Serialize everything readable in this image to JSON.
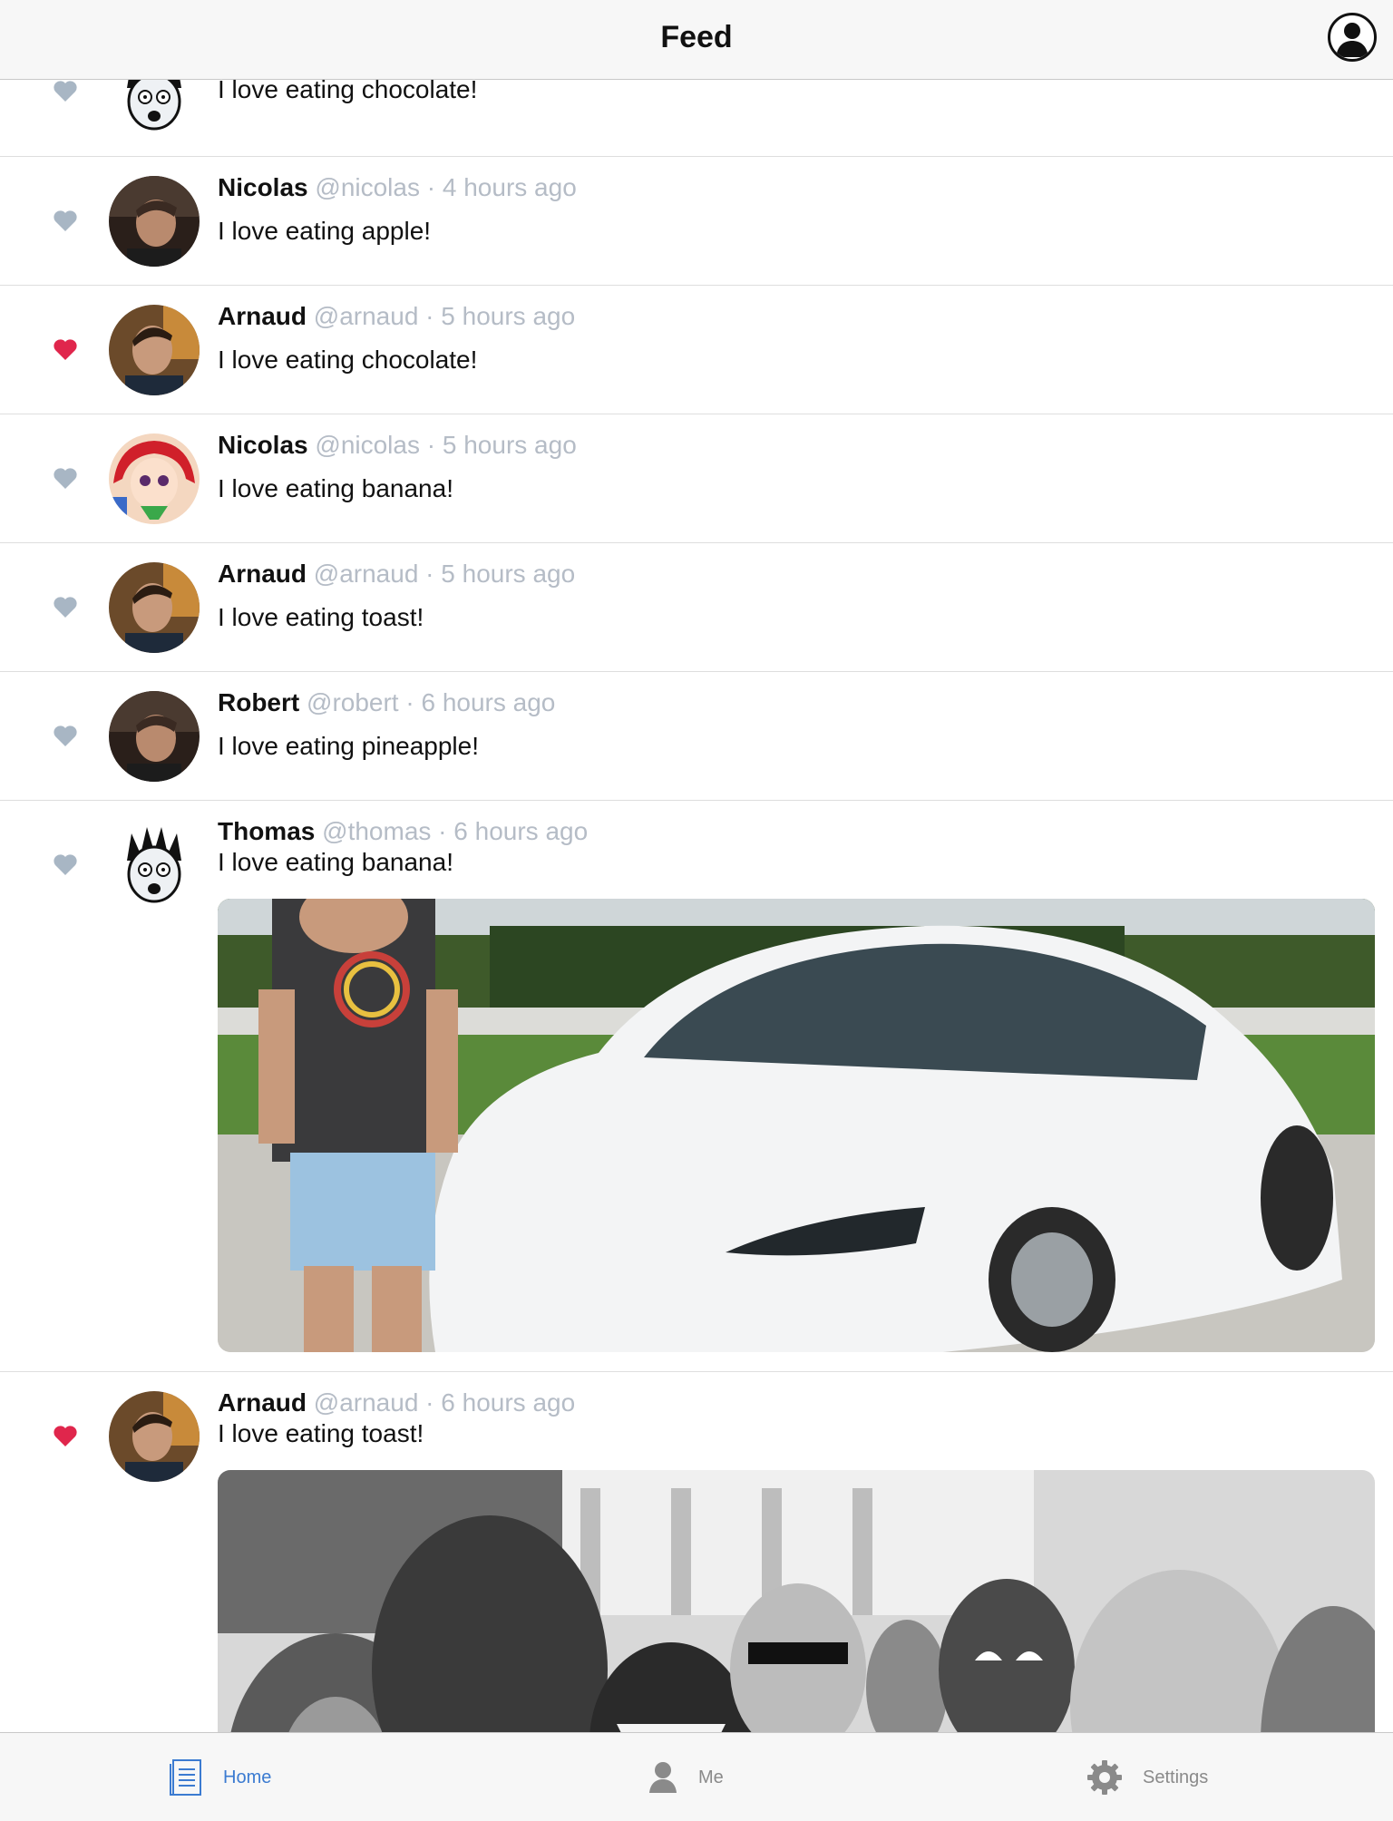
{
  "header": {
    "title": "Feed"
  },
  "colors": {
    "liked": "#e0264c",
    "unliked": "#a8b6c4",
    "accent": "#3b7bd1"
  },
  "partial_post": {
    "text": "I love eating chocolate!",
    "avatar": "thomas-avatar"
  },
  "posts": [
    {
      "name": "Nicolas",
      "handle": "@nicolas",
      "sep": "·",
      "time": "4 hours ago",
      "text": "I love eating apple!",
      "liked": false,
      "avatar": "man-avatar-a"
    },
    {
      "name": "Arnaud",
      "handle": "@arnaud",
      "sep": "·",
      "time": "5 hours ago",
      "text": "I love eating chocolate!",
      "liked": true,
      "avatar": "arnaud-avatar"
    },
    {
      "name": "Nicolas",
      "handle": "@nicolas",
      "sep": "·",
      "time": "5 hours ago",
      "text": "I love eating banana!",
      "liked": false,
      "avatar": "anime-avatar"
    },
    {
      "name": "Arnaud",
      "handle": "@arnaud",
      "sep": "·",
      "time": "5 hours ago",
      "text": "I love eating toast!",
      "liked": false,
      "avatar": "arnaud-avatar"
    },
    {
      "name": "Robert",
      "handle": "@robert",
      "sep": "·",
      "time": "6 hours ago",
      "text": "I love eating pineapple!",
      "liked": false,
      "avatar": "man-avatar-a"
    },
    {
      "name": "Thomas",
      "handle": "@thomas",
      "sep": "·",
      "time": "6 hours ago",
      "text": "I love eating banana!",
      "liked": false,
      "avatar": "thomas-avatar",
      "media": "car-photo"
    },
    {
      "name": "Arnaud",
      "handle": "@arnaud",
      "sep": "·",
      "time": "6 hours ago",
      "text": "I love eating toast!",
      "liked": true,
      "avatar": "arnaud-avatar",
      "media": "superheroes-photo"
    }
  ],
  "tabs": [
    {
      "label": "Home",
      "icon": "document-icon",
      "active": true
    },
    {
      "label": "Me",
      "icon": "person-icon",
      "active": false
    },
    {
      "label": "Settings",
      "icon": "gear-icon",
      "active": false
    }
  ]
}
